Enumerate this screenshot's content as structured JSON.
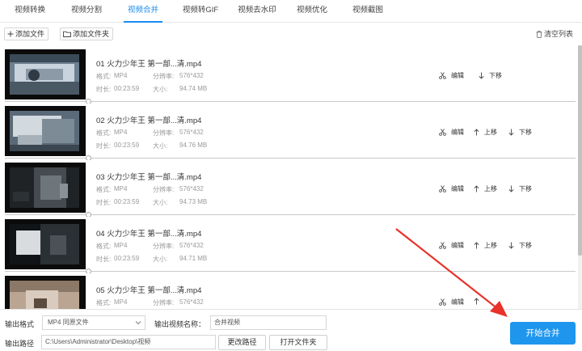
{
  "tabs": [
    {
      "label": "视频转换"
    },
    {
      "label": "视频分割"
    },
    {
      "label": "视频合并"
    },
    {
      "label": "视频转GIF"
    },
    {
      "label": "视频去水印"
    },
    {
      "label": "视频优化"
    },
    {
      "label": "视频截图"
    }
  ],
  "toolbar": {
    "add_file": "添加文件",
    "add_folder": "添加文件夹",
    "clear_list": "清空列表"
  },
  "labels": {
    "format": "格式:",
    "duration": "时长:",
    "resolution": "分辨率:",
    "size": "大小:",
    "edit": "编辑",
    "move_up": "上移",
    "move_down": "下移"
  },
  "files": [
    {
      "name": "01 火力少年王 第一部...清.mp4",
      "format": "MP4",
      "duration": "00:23:59",
      "resolution": "576*432",
      "size": "94.74 MB"
    },
    {
      "name": "02 火力少年王 第一部...清.mp4",
      "format": "MP4",
      "duration": "00:23:59",
      "resolution": "576*432",
      "size": "94.76 MB"
    },
    {
      "name": "03 火力少年王 第一部...清.mp4",
      "format": "MP4",
      "duration": "00:23:59",
      "resolution": "576*432",
      "size": "94.73 MB"
    },
    {
      "name": "04 火力少年王 第一部...清.mp4",
      "format": "MP4",
      "duration": "00:23:59",
      "resolution": "576*432",
      "size": "94.71 MB"
    },
    {
      "name": "05 火力少年王 第一部...清.mp4",
      "format": "MP4",
      "duration": "",
      "resolution": "576*432",
      "size": ""
    }
  ],
  "bottom": {
    "output_format_label": "输出格式",
    "output_format_value": "MP4  同原文件",
    "output_name_label": "输出视频名称：",
    "output_name_value": "合并视频",
    "output_path_label": "输出路径",
    "output_path_value": "C:\\Users\\Administrator\\Desktop\\视频",
    "change_path": "更改路径",
    "open_folder": "打开文件夹",
    "start_merge": "开始合并"
  },
  "colors": {
    "accent": "#1a8cf0",
    "start_button": "#1e96ee",
    "annotation_arrow": "#e8322a"
  }
}
